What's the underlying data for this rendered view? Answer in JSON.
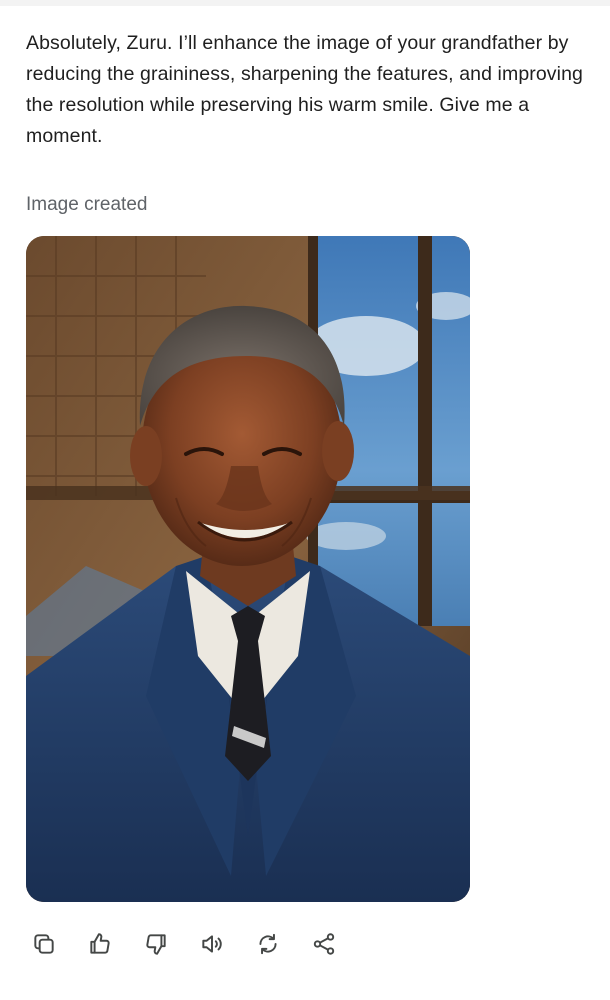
{
  "message": {
    "text": "Absolutely, Zuru. I’ll enhance the image of your grandfather by reducing the graininess, sharpening the features, and improving the resolution while preserving his warm smile. Give me a moment."
  },
  "image": {
    "caption": "Image created"
  },
  "actions": [
    {
      "name": "copy-button",
      "icon": "copy-icon"
    },
    {
      "name": "thumbs-up-button",
      "icon": "thumbs-up-icon"
    },
    {
      "name": "thumbs-down-button",
      "icon": "thumbs-down-icon"
    },
    {
      "name": "read-aloud-button",
      "icon": "speaker-icon"
    },
    {
      "name": "regenerate-button",
      "icon": "regenerate-icon"
    },
    {
      "name": "share-button",
      "icon": "share-icon"
    }
  ],
  "colors": {
    "text": "#1f1f1f",
    "muted": "#5f6368",
    "icon": "#444746"
  }
}
